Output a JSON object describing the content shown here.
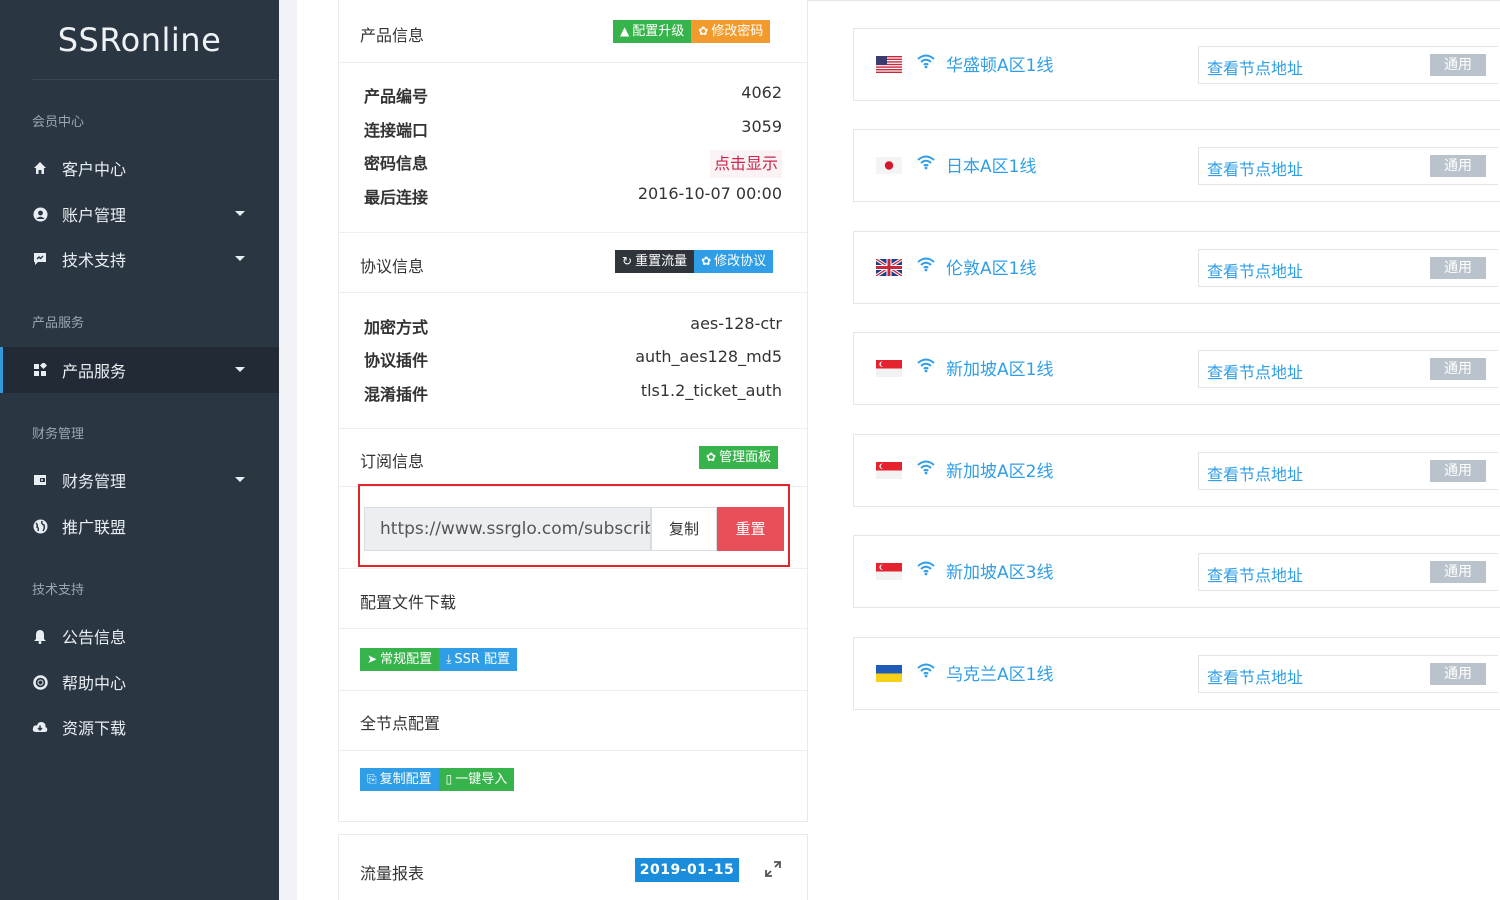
{
  "brand": "SSRonline",
  "sidebar": {
    "heads": [
      "会员中心",
      "产品服务",
      "财务管理",
      "技术支持"
    ],
    "items": [
      {
        "label": "客户中心",
        "icon": "home-icon"
      },
      {
        "label": "账户管理",
        "icon": "user-circle-icon"
      },
      {
        "label": "技术支持",
        "icon": "ticket-icon"
      },
      {
        "label": "产品服务",
        "icon": "grid-icon"
      },
      {
        "label": "财务管理",
        "icon": "wallet-icon"
      },
      {
        "label": "推广联盟",
        "icon": "globe-icon"
      },
      {
        "label": "公告信息",
        "icon": "bell-icon"
      },
      {
        "label": "帮助中心",
        "icon": "lifebuoy-icon"
      },
      {
        "label": "资源下载",
        "icon": "cloud-download-icon"
      }
    ]
  },
  "product": {
    "title": "产品信息",
    "upgrade_label": "配置升级",
    "change_pwd_label": "修改密码",
    "rows": [
      {
        "label": "产品编号",
        "value": "4062"
      },
      {
        "label": "连接端口",
        "value": "3059"
      },
      {
        "label": "密码信息",
        "value": "点击显示"
      },
      {
        "label": "最后连接",
        "value": "2016-10-07 00:00"
      }
    ]
  },
  "protocol": {
    "title": "协议信息",
    "reset_traffic_label": "重置流量",
    "change_protocol_label": "修改协议",
    "rows": [
      {
        "label": "加密方式",
        "value": "aes-128-ctr"
      },
      {
        "label": "协议插件",
        "value": "auth_aes128_md5"
      },
      {
        "label": "混淆插件",
        "value": "tls1.2_ticket_auth"
      }
    ]
  },
  "subscription": {
    "title": "订阅信息",
    "manage_label": "管理面板",
    "url": "https://www.ssrglo.com/subscribe",
    "copy_label": "复制",
    "reset_label": "重置"
  },
  "config_download": {
    "title": "配置文件下载",
    "normal_label": "常规配置",
    "ssr_label": "SSR 配置"
  },
  "all_nodes": {
    "title": "全节点配置",
    "copy_label": "复制配置",
    "import_label": "一键导入"
  },
  "traffic": {
    "title": "流量报表",
    "date": "2019-01-15"
  },
  "nodes": [
    {
      "name": "华盛顿A区1线",
      "flag": "us",
      "link": "查看节点地址",
      "tag": "通用"
    },
    {
      "name": "日本A区1线",
      "flag": "jp",
      "link": "查看节点地址",
      "tag": "通用"
    },
    {
      "name": "伦敦A区1线",
      "flag": "gb",
      "link": "查看节点地址",
      "tag": "通用"
    },
    {
      "name": "新加坡A区1线",
      "flag": "sg",
      "link": "查看节点地址",
      "tag": "通用"
    },
    {
      "name": "新加坡A区2线",
      "flag": "sg",
      "link": "查看节点地址",
      "tag": "通用"
    },
    {
      "name": "新加坡A区3线",
      "flag": "sg",
      "link": "查看节点地址",
      "tag": "通用"
    },
    {
      "name": "乌克兰A区1线",
      "flag": "ua",
      "link": "查看节点地址",
      "tag": "通用"
    }
  ]
}
